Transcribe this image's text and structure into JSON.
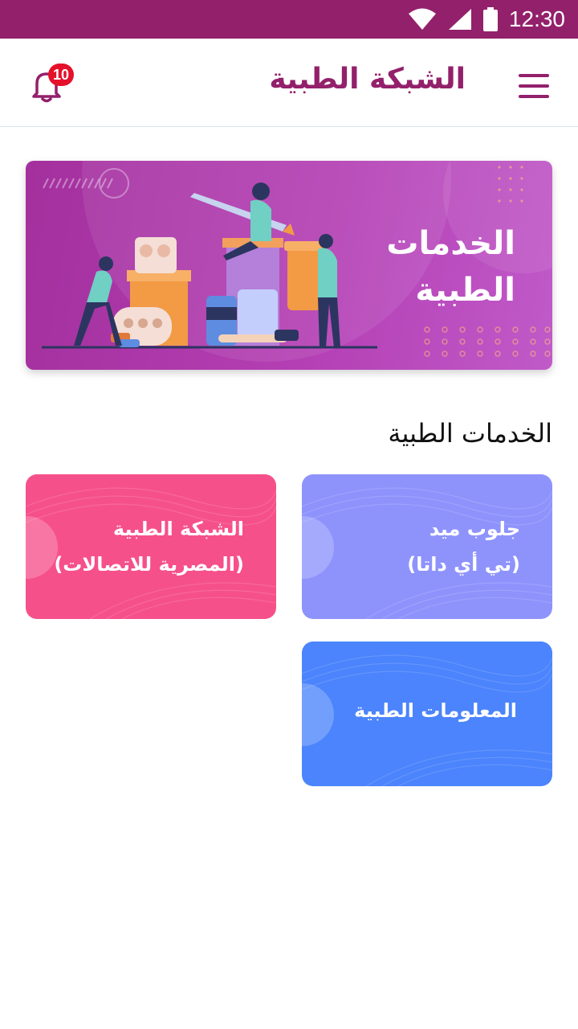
{
  "status_bar": {
    "time": "12:30",
    "icons": [
      "wifi-icon",
      "signal-icon",
      "battery-icon"
    ]
  },
  "app_bar": {
    "title": "الشبكة الطبية",
    "notification_count": "10",
    "icons": [
      "bell-icon",
      "menu-icon"
    ]
  },
  "banner": {
    "line1": "الخدمات",
    "line2": "الطبية"
  },
  "section": {
    "title": "الخدمات الطبية"
  },
  "cards": [
    {
      "line1": "جلوب ميد",
      "line2": "(تي أي داتا)",
      "color": "#8e93fc"
    },
    {
      "line1": "الشبكة الطبية",
      "line2": "(المصرية للاتصالات)",
      "color": "#f6508a"
    },
    {
      "line1": "المعلومات الطبية",
      "line2": "",
      "color": "#4b84fc"
    }
  ],
  "colors": {
    "brand": "#93206b",
    "badge": "#e5112b",
    "banner": "#b43fb4"
  }
}
